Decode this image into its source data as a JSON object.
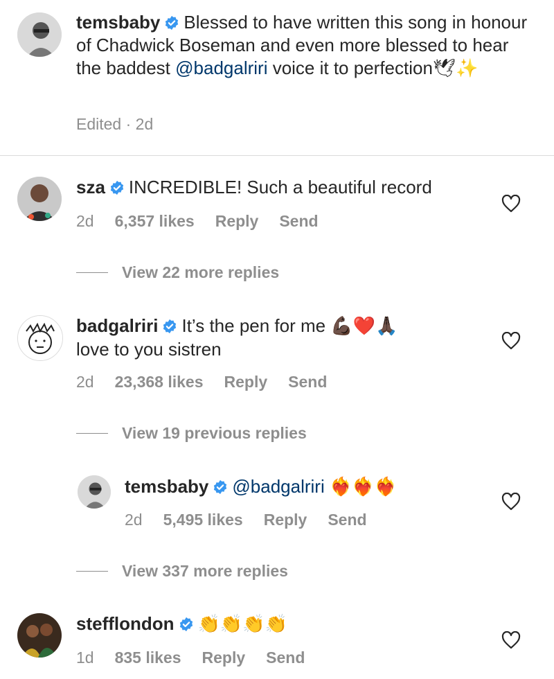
{
  "caption": {
    "username": "temsbaby",
    "text_before": "Blessed to have written this song in honour of Chadwick Boseman and even more blessed to hear the baddest ",
    "mention": "@badgalriri",
    "text_after": " voice it to perfection",
    "emojis": "🕊✨",
    "meta": "Edited · 2d"
  },
  "comments": [
    {
      "username": "sza",
      "text": "INCREDIBLE! Such a beautiful record",
      "time": "2d",
      "likes": "6,357 likes",
      "reply": "Reply",
      "send": "Send",
      "view_replies": "View 22 more replies"
    },
    {
      "username": "badgalriri",
      "text": "It’s the pen for me ",
      "emojis": "💪🏿❤️🙏🏿",
      "text2": "love to you sistren",
      "time": "2d",
      "likes": "23,368 likes",
      "reply": "Reply",
      "send": "Send",
      "view_replies": "View 19 previous replies"
    },
    {
      "username": "temsbaby",
      "mention": "@badgalriri",
      "emojis": "❤️‍🔥❤️‍🔥❤️‍🔥",
      "time": "2d",
      "likes": "5,495 likes",
      "reply": "Reply",
      "send": "Send",
      "view_replies": "View 337 more replies"
    },
    {
      "username": "stefflondon",
      "emojis": "👏👏👏👏",
      "time": "1d",
      "likes": "835 likes",
      "reply": "Reply",
      "send": "Send"
    }
  ],
  "colors": {
    "verified": "#3897f0",
    "mention": "#00376b",
    "muted": "#8e8e8e"
  }
}
